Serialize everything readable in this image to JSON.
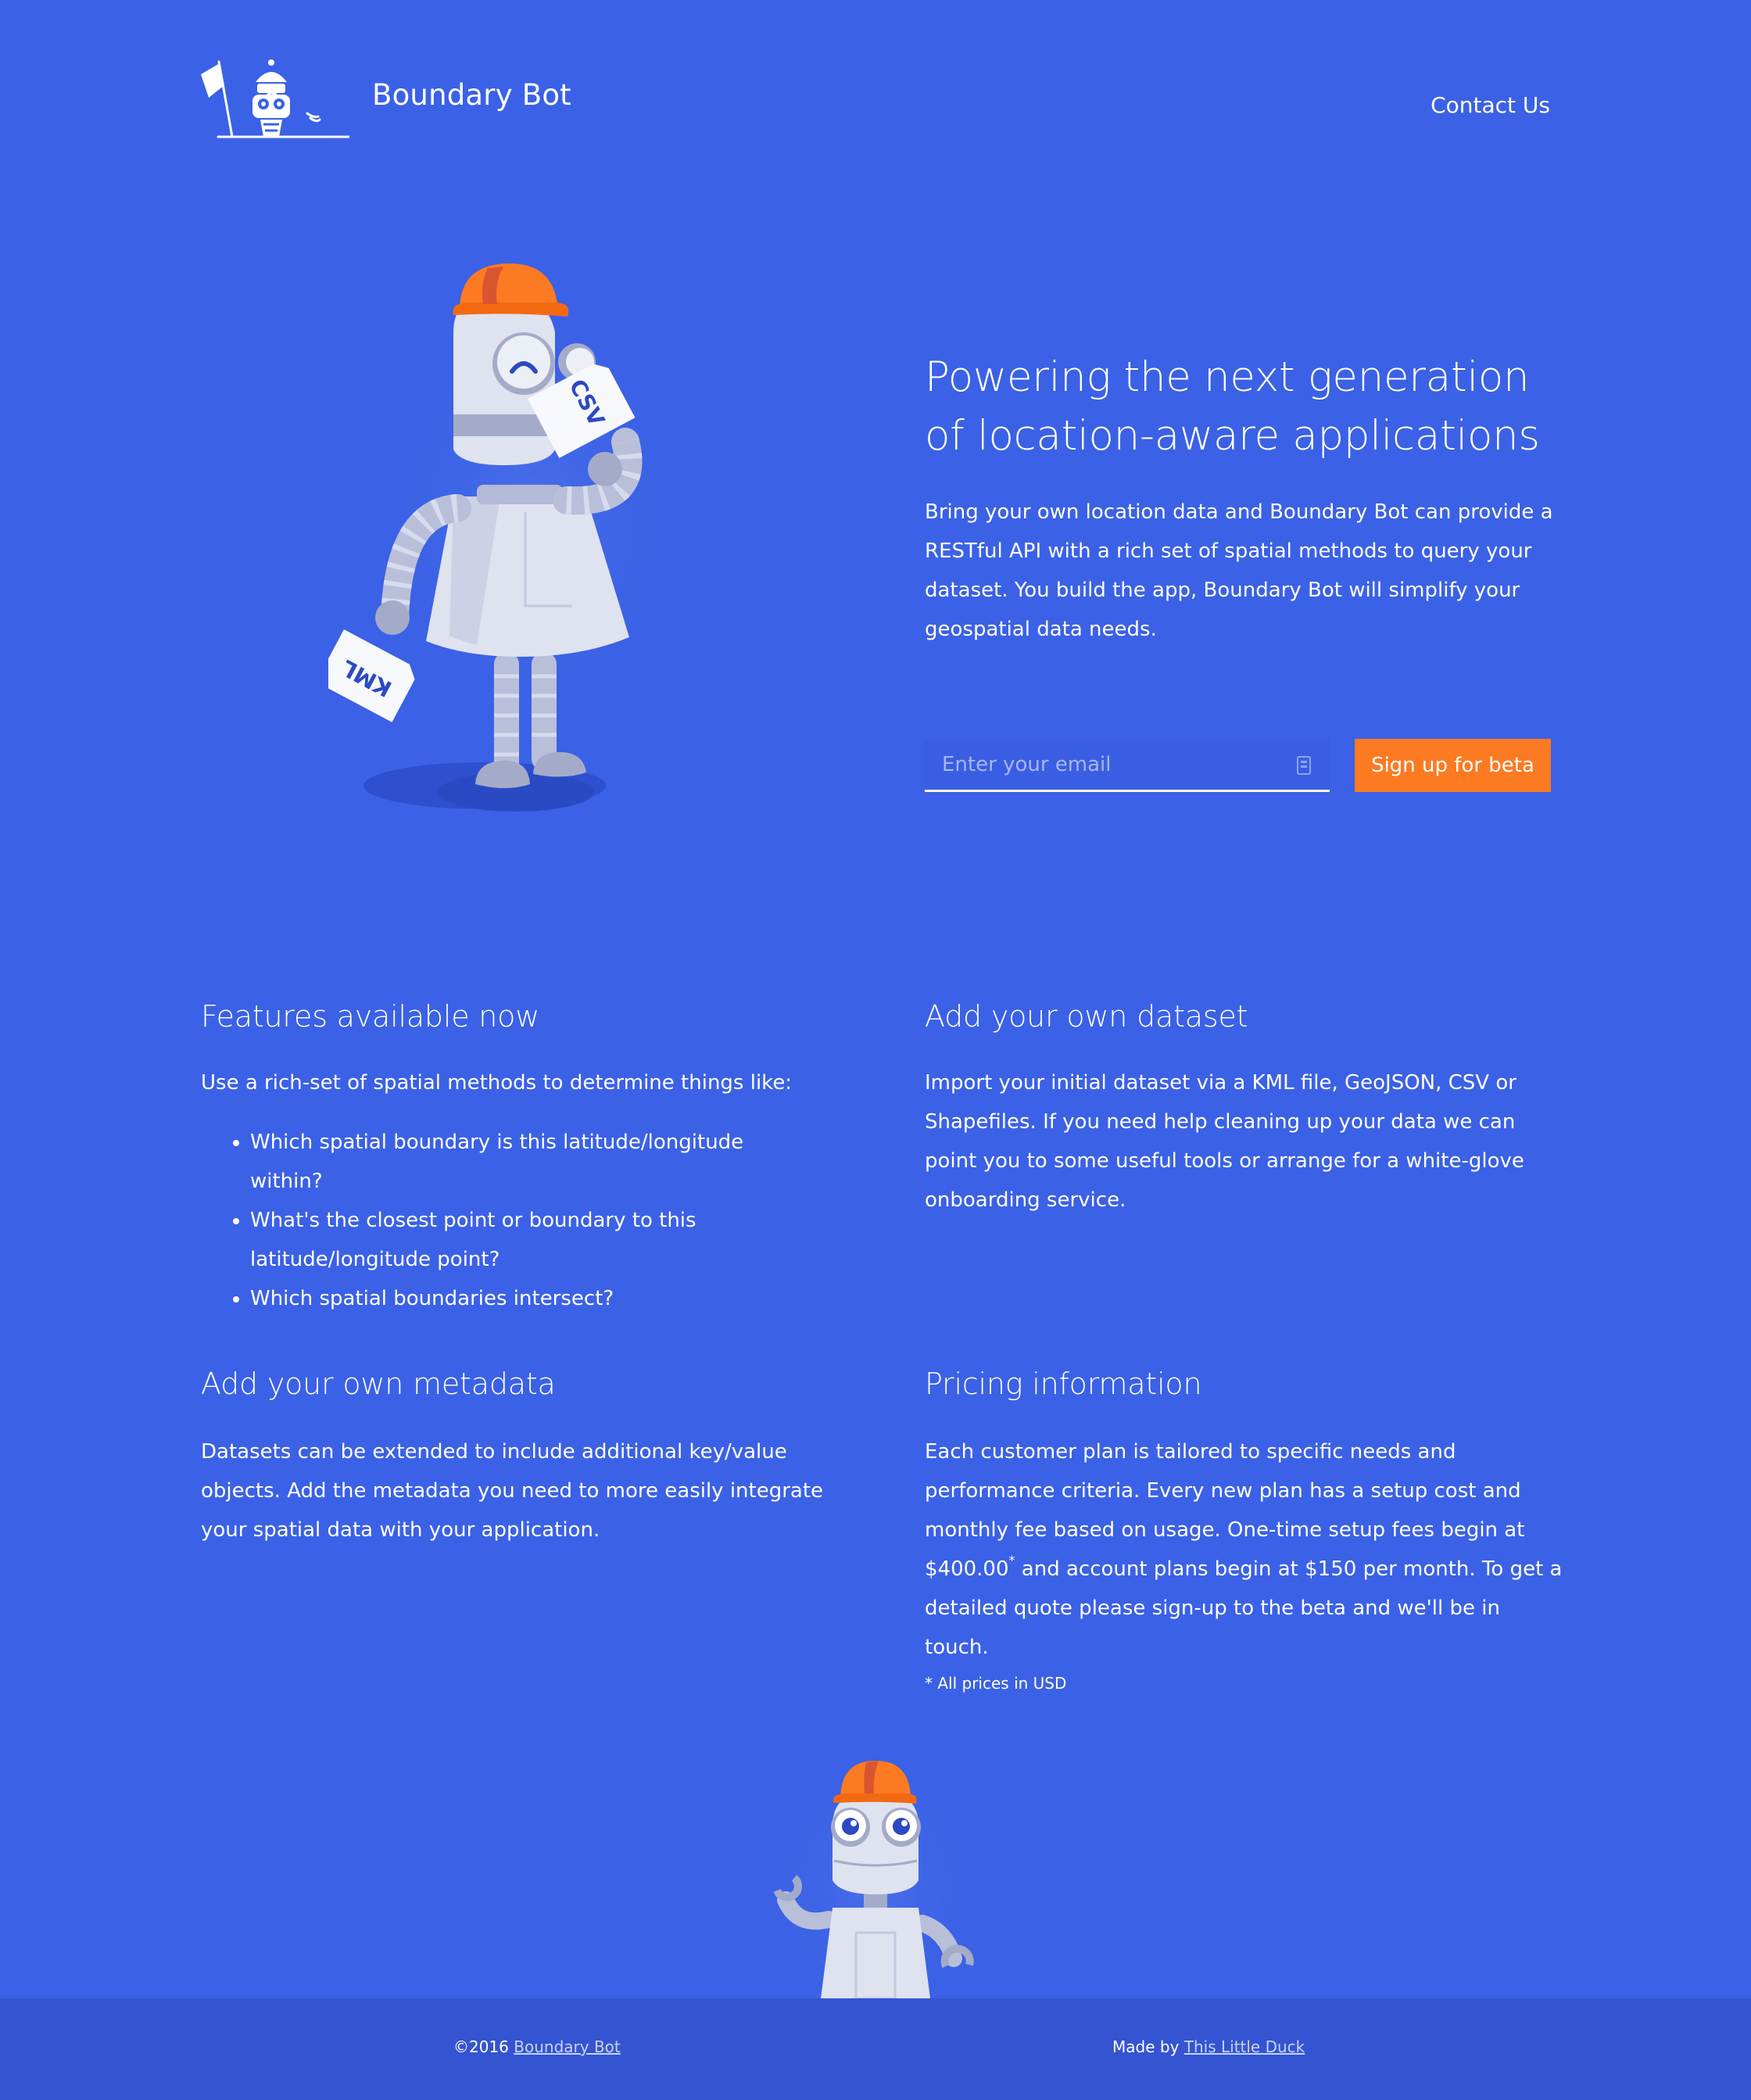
{
  "header": {
    "brand": "Boundary Bot",
    "contact_label": "Contact Us"
  },
  "hero": {
    "title": "Powering the next generation of location-aware applications",
    "description": "Bring your own location data and Boundary Bot can provide a RESTful API with a rich set of spatial methods to query your dataset. You build the app, Boundary Bot will simplify your geospatial data needs.",
    "email_placeholder": "Enter your email",
    "signup_label": "Sign up for beta",
    "paper_labels": [
      "CSV",
      "KML"
    ]
  },
  "features": {
    "title": "Features available now",
    "intro": "Use a rich-set of spatial methods to determine things like:",
    "items": [
      "Which spatial boundary is this latitude/longitude within?",
      "What's the closest point or boundary to this latitude/longitude point?",
      "Which spatial boundaries intersect?"
    ]
  },
  "dataset": {
    "title": "Add your own dataset",
    "text": "Import your initial dataset via a KML file, GeoJSON, CSV or Shapefiles. If you need help cleaning up your data we can point you to some useful tools or arrange for a white-glove onboarding service."
  },
  "metadata": {
    "title": "Add your own metadata",
    "text": "Datasets can be extended to include additional key/value objects. Add the metadata you need to more easily integrate your spatial data with your application."
  },
  "pricing": {
    "title": "Pricing information",
    "text_before": "Each customer plan is tailored to specific needs and performance criteria. Every new plan has a setup cost and monthly fee based on usage. One-time setup fees begin at $400.00",
    "sup": "*",
    "text_after": " and account plans begin at $150 per month. To get a detailed quote please sign-up to the beta and we'll be in touch.",
    "note": "* All prices in USD"
  },
  "footer": {
    "copyright": "©2016 ",
    "copyright_link": "Boundary Bot",
    "made_by": "Made by ",
    "made_by_link": "This Little Duck"
  },
  "colors": {
    "background": "#3b61e6",
    "footer": "#3454d1",
    "accent": "#fc7a22",
    "robot_body": "#dfe2ef"
  },
  "icons": [
    "robot-flag-logo-icon",
    "keyboard-icon",
    "robot-hero-illustration",
    "robot-waving-illustration"
  ]
}
